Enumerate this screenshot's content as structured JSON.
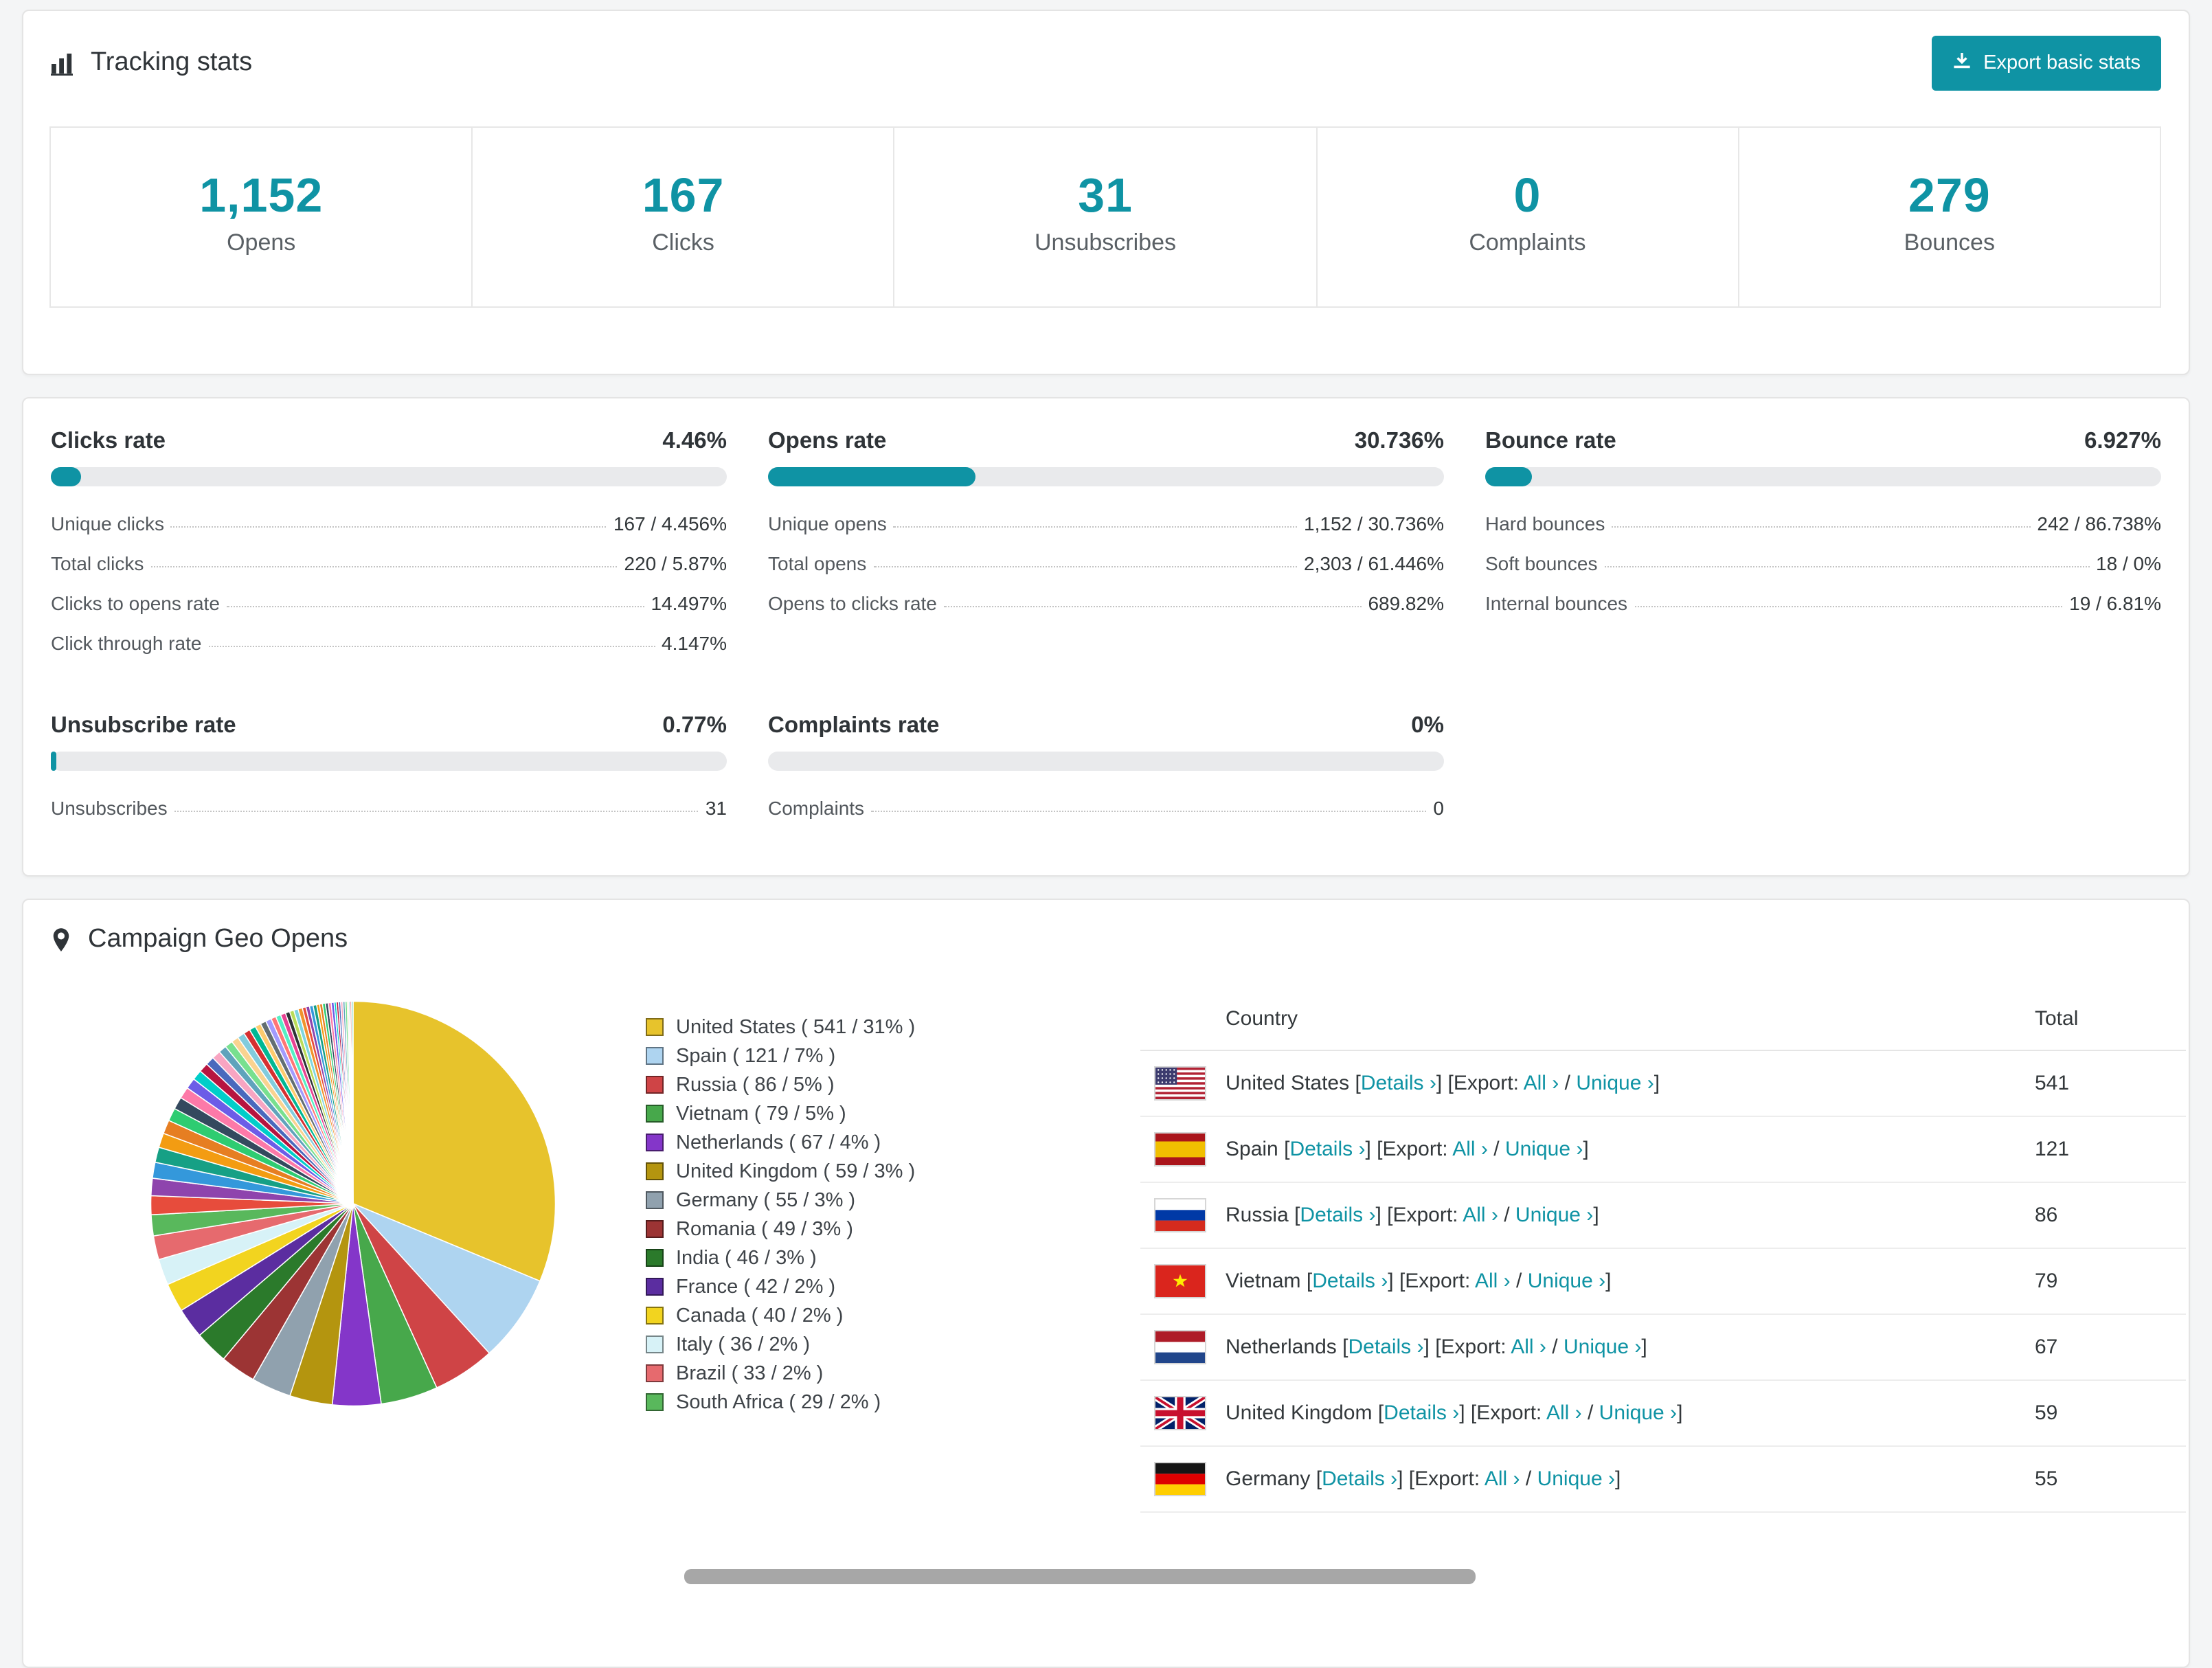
{
  "accent": "#0f93a4",
  "tracking": {
    "title": "Tracking stats",
    "export_button": "Export basic stats",
    "stats": [
      {
        "value": "1,152",
        "label": "Opens"
      },
      {
        "value": "167",
        "label": "Clicks"
      },
      {
        "value": "31",
        "label": "Unsubscribes"
      },
      {
        "value": "0",
        "label": "Complaints"
      },
      {
        "value": "279",
        "label": "Bounces"
      }
    ]
  },
  "rates": [
    {
      "title": "Clicks rate",
      "value": "4.46%",
      "pct": 4.46,
      "rows": [
        {
          "label": "Unique clicks",
          "value": "167 / 4.456%"
        },
        {
          "label": "Total clicks",
          "value": "220 / 5.87%"
        },
        {
          "label": "Clicks to opens rate",
          "value": "14.497%"
        },
        {
          "label": "Click through rate",
          "value": "4.147%"
        }
      ]
    },
    {
      "title": "Opens rate",
      "value": "30.736%",
      "pct": 30.736,
      "rows": [
        {
          "label": "Unique opens",
          "value": "1,152 / 30.736%"
        },
        {
          "label": "Total opens",
          "value": "2,303 / 61.446%"
        },
        {
          "label": "Opens to clicks rate",
          "value": "689.82%"
        }
      ]
    },
    {
      "title": "Bounce rate",
      "value": "6.927%",
      "pct": 6.927,
      "rows": [
        {
          "label": "Hard bounces",
          "value": "242 / 86.738%"
        },
        {
          "label": "Soft bounces",
          "value": "18 / 0%"
        },
        {
          "label": "Internal bounces",
          "value": "19 / 6.81%"
        }
      ]
    },
    {
      "title": "Unsubscribe rate",
      "value": "0.77%",
      "pct": 0.77,
      "rows": [
        {
          "label": "Unsubscribes",
          "value": "31"
        }
      ]
    },
    {
      "title": "Complaints rate",
      "value": "0%",
      "pct": 0,
      "rows": [
        {
          "label": "Complaints",
          "value": "0"
        }
      ]
    }
  ],
  "geo": {
    "title": "Campaign Geo Opens",
    "legend": [
      {
        "label": "United States ( 541 / 31% )",
        "color": "#e7c32c"
      },
      {
        "label": "Spain ( 121 / 7% )",
        "color": "#aed4f0"
      },
      {
        "label": "Russia ( 86 / 5% )",
        "color": "#cf4446"
      },
      {
        "label": "Vietnam ( 79 / 5% )",
        "color": "#47a84b"
      },
      {
        "label": "Netherlands ( 67 / 4% )",
        "color": "#8436c9"
      },
      {
        "label": "United Kingdom ( 59 / 3% )",
        "color": "#b4950f"
      },
      {
        "label": "Germany ( 55 / 3% )",
        "color": "#90a1ae"
      },
      {
        "label": "Romania ( 49 / 3% )",
        "color": "#9c3434"
      },
      {
        "label": "India ( 46 / 3% )",
        "color": "#2b7a2b"
      },
      {
        "label": "France ( 42 / 2% )",
        "color": "#5b2da0"
      },
      {
        "label": "Canada ( 40 / 2% )",
        "color": "#f2d41f"
      },
      {
        "label": "Italy ( 36 / 2% )",
        "color": "#d7f2f7"
      },
      {
        "label": "Brazil ( 33 / 2% )",
        "color": "#e66a6e"
      },
      {
        "label": "South Africa ( 29 / 2% )",
        "color": "#59b85c"
      }
    ],
    "table": {
      "country_header": "Country",
      "total_header": "Total",
      "lb": "[",
      "rb": "]",
      "export_prefix": "[Export:",
      "slash": "/",
      "links": {
        "details": "Details ›",
        "all": "All ›",
        "unique": "Unique ›"
      },
      "rows": [
        {
          "flag": "us",
          "country": "United States",
          "total": "541"
        },
        {
          "flag": "es",
          "country": "Spain",
          "total": "121"
        },
        {
          "flag": "ru",
          "country": "Russia",
          "total": "86"
        },
        {
          "flag": "vn",
          "country": "Vietnam",
          "total": "79"
        },
        {
          "flag": "nl",
          "country": "Netherlands",
          "total": "67"
        },
        {
          "flag": "gb",
          "country": "United Kingdom",
          "total": "59"
        },
        {
          "flag": "de",
          "country": "Germany",
          "total": "55"
        }
      ]
    },
    "chart_data": {
      "type": "pie",
      "title": "Campaign Geo Opens",
      "slices": [
        {
          "label": "United States",
          "value": 541,
          "pct": "31%",
          "color": "#e7c32c"
        },
        {
          "label": "Spain",
          "value": 121,
          "pct": "7%",
          "color": "#aed4f0"
        },
        {
          "label": "Russia",
          "value": 86,
          "pct": "5%",
          "color": "#cf4446"
        },
        {
          "label": "Vietnam",
          "value": 79,
          "pct": "5%",
          "color": "#47a84b"
        },
        {
          "label": "Netherlands",
          "value": 67,
          "pct": "4%",
          "color": "#8436c9"
        },
        {
          "label": "United Kingdom",
          "value": 59,
          "pct": "3%",
          "color": "#b4950f"
        },
        {
          "label": "Germany",
          "value": 55,
          "pct": "3%",
          "color": "#90a1ae"
        },
        {
          "label": "Romania",
          "value": 49,
          "pct": "3%",
          "color": "#9c3434"
        },
        {
          "label": "India",
          "value": 46,
          "pct": "3%",
          "color": "#2b7a2b"
        },
        {
          "label": "France",
          "value": 42,
          "pct": "2%",
          "color": "#5b2da0"
        },
        {
          "label": "Canada",
          "value": 40,
          "pct": "2%",
          "color": "#f2d41f"
        },
        {
          "label": "Italy",
          "value": 36,
          "pct": "2%",
          "color": "#d7f2f7"
        },
        {
          "label": "Brazil",
          "value": 33,
          "pct": "2%",
          "color": "#e66a6e"
        },
        {
          "label": "South Africa",
          "value": 29,
          "pct": "2%",
          "color": "#59b85c"
        }
      ],
      "others_values": [
        26,
        24,
        22,
        21,
        20,
        19,
        18,
        17,
        16,
        15,
        14,
        13,
        12,
        12,
        11,
        11,
        10,
        10,
        9,
        9,
        8,
        8,
        8,
        7,
        7,
        7,
        6,
        6,
        6,
        6,
        5,
        5,
        5,
        5,
        4,
        4,
        4,
        4,
        4,
        4,
        3,
        3,
        3,
        3,
        3,
        3,
        2,
        2,
        2,
        2
      ],
      "others_palette": [
        "#e74c3c",
        "#8e44ad",
        "#3498db",
        "#16a085",
        "#f39c12",
        "#e67e22",
        "#2ecc71",
        "#34495e",
        "#fd79a8",
        "#6c5ce7",
        "#00cec9",
        "#b71540",
        "#4a69bd",
        "#f8a5c2",
        "#60a3bc",
        "#78e08f",
        "#fad390",
        "#82ccdd",
        "#d63031",
        "#00b894",
        "#fdcb6e",
        "#636e72",
        "#a29bfe",
        "#ff7675",
        "#55efc4",
        "#e84393",
        "#2d3436",
        "#badc58",
        "#7ed6df",
        "#f0932b"
      ]
    }
  }
}
